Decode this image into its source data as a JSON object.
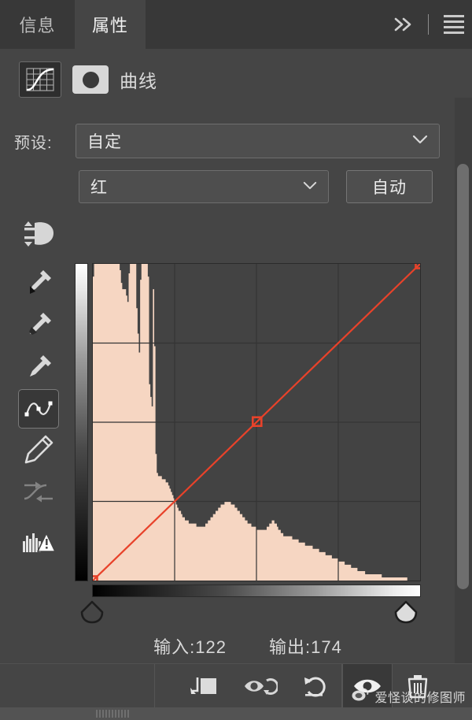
{
  "window": {
    "tabs": [
      {
        "label": "信息",
        "name": "tab-info",
        "active": false
      },
      {
        "label": "属性",
        "name": "tab-properties",
        "active": true
      }
    ],
    "collapse_icon": "double-chevron-right-icon",
    "menu_icon": "panel-menu-icon"
  },
  "header": {
    "adjustment_icon": "curves-adjustment-icon",
    "mask_thumbnail_icon": "layer-mask-thumbnail-icon",
    "title": "曲线"
  },
  "preset": {
    "label": "预设:",
    "value": "自定",
    "dropdown_icon": "chevron-down-icon"
  },
  "channel": {
    "target_adjustment_icon": "on-image-adjustment-icon",
    "value": "红",
    "dropdown_icon": "chevron-down-icon",
    "auto_label": "自动"
  },
  "tools": [
    {
      "name": "tool-black-point-eyedropper",
      "icon": "eyedropper-black-icon",
      "selected": false,
      "dim": false
    },
    {
      "name": "tool-gray-point-eyedropper",
      "icon": "eyedropper-gray-icon",
      "selected": false,
      "dim": false
    },
    {
      "name": "tool-white-point-eyedropper",
      "icon": "eyedropper-white-icon",
      "selected": false,
      "dim": false
    },
    {
      "name": "tool-curve-point",
      "icon": "curve-point-tool-icon",
      "selected": true,
      "dim": false
    },
    {
      "name": "tool-pencil-draw-curve",
      "icon": "pencil-icon",
      "selected": false,
      "dim": false
    },
    {
      "name": "tool-smooth-curve",
      "icon": "smooth-curve-icon",
      "selected": false,
      "dim": true
    },
    {
      "name": "tool-histogram-warning",
      "icon": "histogram-warning-icon",
      "selected": false,
      "dim": false
    }
  ],
  "readout": {
    "input_label": "输入:",
    "input_value": "122",
    "output_label": "输出:",
    "output_value": "174"
  },
  "sliders": {
    "black_point_handle": "black-point-handle",
    "white_point_handle": "white-point-handle"
  },
  "footer": {
    "buttons": [
      {
        "name": "clip-to-layer-button",
        "icon": "clip-to-layer-icon",
        "active": false
      },
      {
        "name": "toggle-previous-state-button",
        "icon": "eye-previous-state-icon",
        "active": false
      },
      {
        "name": "reset-adjustment-button",
        "icon": "reset-arrow-icon",
        "active": false
      },
      {
        "name": "toggle-visibility-button",
        "icon": "eye-icon",
        "active": true
      },
      {
        "name": "delete-adjustment-button",
        "icon": "trash-icon",
        "active": false
      }
    ]
  },
  "watermark": {
    "logo_icon": "weibo-logo-icon",
    "text": "爱怪谈的修图师"
  },
  "colors": {
    "panel_bg": "#454545",
    "tabbar_bg": "#383838",
    "graph_bg": "#434343",
    "curve_red": "#e8422a",
    "histogram": "#f6d6c2",
    "text": "#dcdcdc"
  },
  "chart_data": {
    "type": "line",
    "title": "曲线",
    "channel": "红",
    "xlabel": "输入",
    "ylabel": "输出",
    "xlim": [
      0,
      255
    ],
    "ylim": [
      0,
      255
    ],
    "grid": true,
    "grid_divisions": 4,
    "curve_points": [
      {
        "input": 0,
        "output": 0
      },
      {
        "input": 128,
        "output": 128
      },
      {
        "input": 255,
        "output": 255
      }
    ],
    "selected_point": {
      "input": 122,
      "output": 174
    },
    "baseline": {
      "from": [
        0,
        0
      ],
      "to": [
        255,
        255
      ]
    },
    "histogram": {
      "color": "#f6d6c2",
      "bins": [
        96,
        100,
        100,
        100,
        100,
        100,
        100,
        100,
        100,
        100,
        100,
        100,
        100,
        100,
        100,
        100,
        100,
        100,
        100,
        100,
        100,
        98,
        94,
        92,
        92,
        92,
        90,
        88,
        97,
        100,
        100,
        100,
        100,
        100,
        86,
        78,
        72,
        95,
        100,
        100,
        100,
        100,
        100,
        96,
        62,
        58,
        55,
        92,
        74,
        40,
        34,
        33,
        33,
        33,
        32,
        32,
        32,
        31,
        31,
        30,
        29,
        28,
        27,
        26,
        25,
        24,
        23,
        22,
        22,
        21,
        20,
        20,
        19,
        19,
        19,
        18,
        18,
        18,
        18,
        18,
        18,
        17,
        17,
        17,
        17,
        17,
        17,
        17,
        18,
        18,
        19,
        19,
        20,
        20,
        21,
        21,
        22,
        22,
        23,
        23,
        24,
        24,
        24,
        25,
        25,
        25,
        25,
        25,
        24,
        24,
        24,
        23,
        23,
        22,
        22,
        21,
        21,
        20,
        20,
        19,
        19,
        18,
        18,
        18,
        17,
        17,
        17,
        17,
        16,
        16,
        16,
        16,
        16,
        16,
        16,
        16,
        17,
        17,
        18,
        18,
        19,
        19,
        18,
        18,
        17,
        16,
        16,
        15,
        15,
        14,
        14,
        14,
        14,
        14,
        14,
        14,
        13,
        13,
        13,
        13,
        13,
        12,
        12,
        12,
        12,
        12,
        11,
        11,
        11,
        11,
        11,
        11,
        10,
        10,
        10,
        10,
        10,
        9,
        9,
        9,
        9,
        9,
        8,
        8,
        8,
        8,
        8,
        7,
        7,
        7,
        7,
        7,
        6,
        6,
        6,
        6,
        6,
        5,
        5,
        5,
        5,
        5,
        4,
        4,
        4,
        4,
        4,
        3,
        3,
        3,
        3,
        3,
        3,
        2,
        2,
        2,
        2,
        2,
        2,
        2,
        2,
        2,
        2,
        2,
        2,
        2,
        1,
        1,
        1,
        1,
        1,
        1,
        1,
        1,
        1,
        1,
        1,
        1,
        1,
        1,
        1,
        1,
        1,
        1,
        1,
        1,
        0,
        0,
        0,
        0,
        0,
        0,
        0,
        0,
        0,
        0
      ]
    }
  }
}
